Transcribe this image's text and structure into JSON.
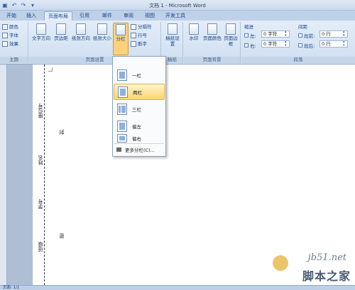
{
  "window": {
    "title": "文档 1 - Microsoft Word"
  },
  "tabs": [
    "开始",
    "插入",
    "页面布局",
    "引用",
    "邮件",
    "审阅",
    "视图",
    "开发工具"
  ],
  "active_tab": "页面布局",
  "ribbon": {
    "theme": {
      "label": "主题",
      "colors": "颜色",
      "fonts": "字体",
      "effects": "效果"
    },
    "page_setup": {
      "label": "页面设置",
      "text_direction": "文字方向",
      "margins": "页边距",
      "orientation": "纸张方向",
      "size": "纸张大小",
      "columns": "分栏",
      "breaks": "分隔符",
      "line_numbers": "行号",
      "hyphenation": "断字"
    },
    "manuscript": {
      "label": "稿纸",
      "button": "稿纸设置"
    },
    "page_background": {
      "label": "页面背景",
      "watermark": "水印",
      "page_color": "页面颜色",
      "page_borders": "页面边框"
    },
    "paragraph": {
      "label": "段落",
      "indent_title": "缩进",
      "spacing_title": "间距",
      "indent_left_label": "左:",
      "indent_left_value": "0 字符",
      "indent_right_label": "右:",
      "indent_right_value": "0 字符",
      "spacing_before_label": "段前:",
      "spacing_before_value": "0 行",
      "spacing_after_label": "段后:",
      "spacing_after_value": "0 行"
    }
  },
  "columns_menu": {
    "items": [
      "一栏",
      "两栏",
      "三栏",
      "偏左",
      "偏右"
    ],
    "hovered": "两栏",
    "more": "更多分栏(C)..."
  },
  "document": {
    "labels": [
      "座位号",
      "姓名",
      "学号",
      "班级"
    ],
    "seal_chars": [
      "封",
      "密"
    ]
  },
  "status": {
    "text": "页面: 1/1"
  },
  "watermark": {
    "site": "jb51.net",
    "name": "脚本之家"
  }
}
